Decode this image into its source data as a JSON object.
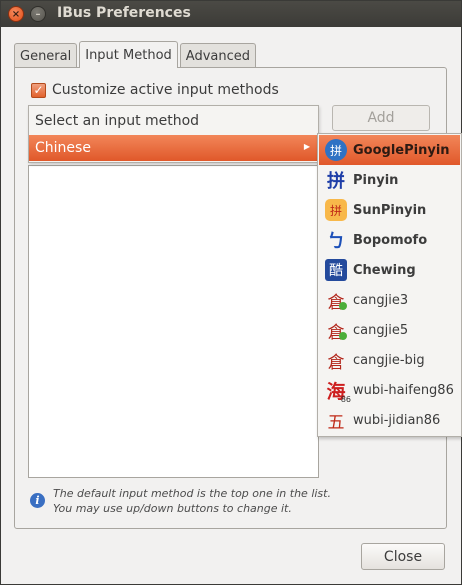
{
  "window": {
    "title": "IBus Preferences",
    "close_glyph": "×",
    "minimize_glyph": "–"
  },
  "tabs": [
    {
      "label": "General",
      "active": false
    },
    {
      "label": "Input Method",
      "active": true
    },
    {
      "label": "Advanced",
      "active": false
    }
  ],
  "customize": {
    "label": "Customize active input methods",
    "checked": true
  },
  "add_button": {
    "label": "Add",
    "enabled": false
  },
  "menu": {
    "header": "Select an input method",
    "selected": "Chinese",
    "arrow_icon": "submenu-arrow-icon"
  },
  "submenu": {
    "items": [
      {
        "label": "GooglePinyin",
        "icon": "googlepinyin-icon",
        "glyph": "拼",
        "selected": true,
        "bold": true
      },
      {
        "label": "Pinyin",
        "icon": "pinyin-icon",
        "glyph": "拼",
        "selected": false,
        "bold": true
      },
      {
        "label": "SunPinyin",
        "icon": "sunpinyin-icon",
        "glyph": "拼",
        "selected": false,
        "bold": true
      },
      {
        "label": "Bopomofo",
        "icon": "bopomofo-icon",
        "glyph": "ㄅ",
        "selected": false,
        "bold": true
      },
      {
        "label": "Chewing",
        "icon": "chewing-icon",
        "glyph": "酷",
        "selected": false,
        "bold": true
      },
      {
        "label": "cangjie3",
        "icon": "cangjie3-icon",
        "glyph": "倉",
        "selected": false,
        "bold": false
      },
      {
        "label": "cangjie5",
        "icon": "cangjie5-icon",
        "glyph": "倉",
        "selected": false,
        "bold": false
      },
      {
        "label": "cangjie-big",
        "icon": "cangjie-big-icon",
        "glyph": "倉",
        "selected": false,
        "bold": false
      },
      {
        "label": "wubi-haifeng86",
        "icon": "wubi-haifeng86-icon",
        "glyph": "海",
        "badge": "86",
        "selected": false,
        "bold": false
      },
      {
        "label": "wubi-jidian86",
        "icon": "wubi-jidian86-icon",
        "glyph": "五",
        "selected": false,
        "bold": false
      }
    ]
  },
  "info": {
    "icon": "info-icon",
    "glyph": "i",
    "line1": "The default input method is the top one in the list.",
    "line2": "You may use up/down buttons to change it."
  },
  "close_button": {
    "label": "Close"
  },
  "colors": {
    "accent": "#e0582a",
    "titlebar": "#3c3b37",
    "window_bg": "#f2f1f0"
  }
}
